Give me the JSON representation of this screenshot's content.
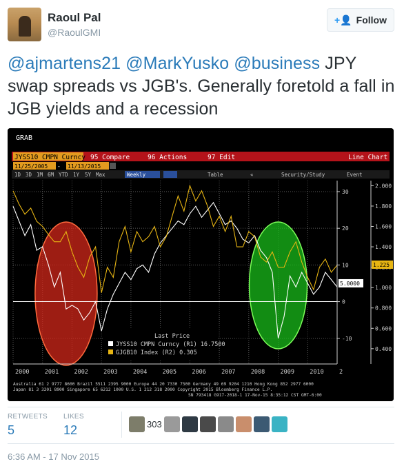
{
  "tweet": {
    "author_name": "Raoul Pal",
    "author_handle": "@RaoulGMI",
    "follow_label": "Follow",
    "mentions": [
      "@ajmartens21",
      "@MarkYusko",
      "@business"
    ],
    "body_text": "JPY swap spreads vs JGB's. Generally foretold a fall in JGB yields and a recession",
    "stats": {
      "retweets_label": "RETWEETS",
      "retweets_count": "5",
      "likes_label": "LIKES",
      "likes_count": "12"
    },
    "likers_extra": "303",
    "timestamp": "6:36 AM - 17 Nov 2015"
  },
  "terminal": {
    "header": "GRAB",
    "ticker_field": "JYSS10 CMPN Curncy",
    "menu": [
      "95 Compare",
      "96 Actions",
      "97 Edit"
    ],
    "chart_type_label": "Line Chart",
    "date_from": "11/25/2005",
    "date_to": "11/13/2015",
    "periods": [
      "1D",
      "3D",
      "1M",
      "6M",
      "YTD",
      "1Y",
      "5Y",
      "Max"
    ],
    "frequency": "Weekly",
    "toolbar_items": [
      "Table",
      "Security/Study",
      "Event"
    ],
    "legend": {
      "title": "Last Price",
      "series1": "JYSS10 CMPN Curncy (R1) 16.7500",
      "series2": "GJGB10 Index (R2)         0.305"
    },
    "footer_line1": "Australia 61 2 9777 8600 Brazil 5511 2395 9000 Europe 44 20 7330 7500 Germany 49 69 9204 1210 Hong Kong 852 2977 6000",
    "footer_line2": "Japan 81 3 3201 8900        Singapore 65 6212 1000        U.S. 1 212 318 2000        Copyright 2015 Bloomberg Finance L.P.",
    "footer_line3": "SN 793418 G917-2018-1 17-Nov-15  8:35:12 CST  GMT-6:00",
    "colors": {
      "series1": "#ffffff",
      "series2": "#e7b513",
      "recession_red": "#d9281a",
      "highlight_green": "#19c21a"
    }
  },
  "chart_data": {
    "type": "line",
    "x_ticks": [
      "2000",
      "2001",
      "2002",
      "2003",
      "2004",
      "2005",
      "2006",
      "2007",
      "2008",
      "2009",
      "2010",
      "2"
    ],
    "y_left_ticks": [
      "30",
      "20",
      "10",
      "0",
      "-10"
    ],
    "y_right_ticks": [
      "2.000",
      "1.800",
      "1.600",
      "1.400",
      "1.200",
      "1.000",
      "0.800",
      "0.600",
      "0.400"
    ],
    "ylim_left": [
      -17,
      33
    ],
    "ylim_right": [
      0.25,
      2.05
    ],
    "last_value_labels": [
      "1.225",
      "5.0000"
    ],
    "series": [
      {
        "name": "JYSS10 CMPN Curncy",
        "axis": "left",
        "color": "#ffffff",
        "x": [
          2000.0,
          2000.2,
          2000.4,
          2000.6,
          2000.8,
          2001.0,
          2001.2,
          2001.4,
          2001.6,
          2001.8,
          2002.0,
          2002.2,
          2002.4,
          2002.6,
          2002.8,
          2003.0,
          2003.2,
          2003.4,
          2003.6,
          2003.8,
          2004.0,
          2004.2,
          2004.4,
          2004.6,
          2004.8,
          2005.0,
          2005.2,
          2005.4,
          2005.6,
          2005.8,
          2006.0,
          2006.2,
          2006.4,
          2006.6,
          2006.8,
          2007.0,
          2007.2,
          2007.4,
          2007.6,
          2007.8,
          2008.0,
          2008.2,
          2008.4,
          2008.6,
          2008.8,
          2009.0,
          2009.2,
          2009.4,
          2009.6,
          2009.8,
          2010.0,
          2010.2,
          2010.4,
          2010.6,
          2010.8,
          2011.0
        ],
        "values": [
          26,
          22,
          18,
          21,
          14,
          15,
          10,
          4,
          8,
          -2,
          -1,
          -2,
          -5,
          -3,
          0,
          -8,
          -2,
          2,
          5,
          8,
          6,
          9,
          10,
          8,
          13,
          16,
          18,
          20,
          22,
          21,
          24,
          26,
          23,
          25,
          27,
          24,
          21,
          22,
          20,
          17,
          16,
          18,
          14,
          12,
          8,
          -10,
          -4,
          7,
          4,
          8,
          5,
          2,
          4,
          8,
          6,
          4
        ]
      },
      {
        "name": "GJGB10 Index",
        "axis": "right",
        "color": "#e7b513",
        "x": [
          2000.0,
          2000.2,
          2000.4,
          2000.6,
          2000.8,
          2001.0,
          2001.2,
          2001.4,
          2001.6,
          2001.8,
          2002.0,
          2002.2,
          2002.4,
          2002.6,
          2002.8,
          2003.0,
          2003.2,
          2003.4,
          2003.6,
          2003.8,
          2004.0,
          2004.2,
          2004.4,
          2004.6,
          2004.8,
          2005.0,
          2005.2,
          2005.4,
          2005.6,
          2005.8,
          2006.0,
          2006.2,
          2006.4,
          2006.6,
          2006.8,
          2007.0,
          2007.2,
          2007.4,
          2007.6,
          2007.8,
          2008.0,
          2008.2,
          2008.4,
          2008.6,
          2008.8,
          2009.0,
          2009.2,
          2009.4,
          2009.6,
          2009.8,
          2010.0,
          2010.2,
          2010.4,
          2010.6,
          2010.8,
          2011.0
        ],
        "values": [
          1.95,
          1.82,
          1.72,
          1.78,
          1.65,
          1.6,
          1.52,
          1.45,
          1.45,
          1.55,
          1.35,
          1.2,
          1.1,
          1.3,
          1.4,
          0.95,
          1.2,
          1.1,
          1.45,
          1.6,
          1.35,
          1.55,
          1.45,
          1.5,
          1.6,
          1.4,
          1.5,
          1.7,
          1.9,
          1.75,
          2.0,
          1.85,
          1.95,
          1.8,
          1.6,
          1.7,
          1.55,
          1.7,
          1.4,
          1.4,
          1.55,
          1.5,
          1.3,
          1.25,
          1.35,
          1.2,
          1.2,
          1.35,
          1.45,
          1.25,
          1.1,
          0.98,
          1.2,
          1.28,
          1.15,
          1.22
        ]
      }
    ]
  }
}
